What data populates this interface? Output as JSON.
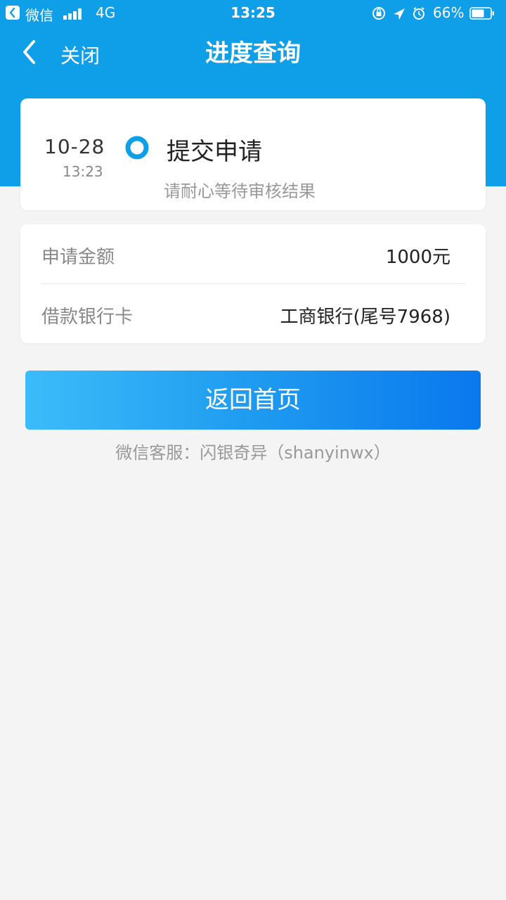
{
  "status_bar": {
    "app": "微信",
    "network": "4G",
    "time": "13:25",
    "battery": "66%"
  },
  "nav": {
    "back_label": "关闭",
    "title": "进度查询"
  },
  "progress": {
    "date": "10-28",
    "time": "13:23",
    "status": "提交申请",
    "description": "请耐心等待审核结果"
  },
  "info": {
    "rows": [
      {
        "label": "申请金额",
        "value": "1000元"
      },
      {
        "label": "借款银行卡",
        "value": "工商银行(尾号7968)"
      }
    ]
  },
  "actions": {
    "home_label": "返回首页"
  },
  "footer": {
    "service_text": "微信客服：闪银奇异（shanyinwx）"
  },
  "colors": {
    "brand": "#0f9ee8",
    "button_start": "#3cbcfa",
    "button_end": "#0a78ee",
    "page_bg": "#f4f4f4"
  },
  "icons": {
    "back": "chevron-left-icon",
    "status_dot": "radio-dot-icon",
    "signal": "signal-bars-icon",
    "battery": "battery-icon"
  }
}
